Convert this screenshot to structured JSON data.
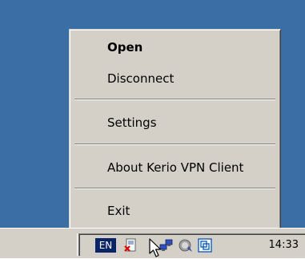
{
  "menu": {
    "items": [
      {
        "label": "Open",
        "bold": true
      },
      {
        "label": "Disconnect"
      },
      {
        "label": "Settings"
      },
      {
        "label": "About Kerio VPN Client"
      },
      {
        "label": "Exit"
      }
    ]
  },
  "taskbar": {
    "language": "EN",
    "clock": "14:33",
    "tray_icons": [
      "kerio-vpn-disconnected-icon",
      "network-icon",
      "volume-icon",
      "vmware-icon"
    ]
  },
  "colors": {
    "desktop": "#3a6ea5",
    "menu_bg": "#d4d0c8",
    "lang_bg": "#0a246a"
  }
}
